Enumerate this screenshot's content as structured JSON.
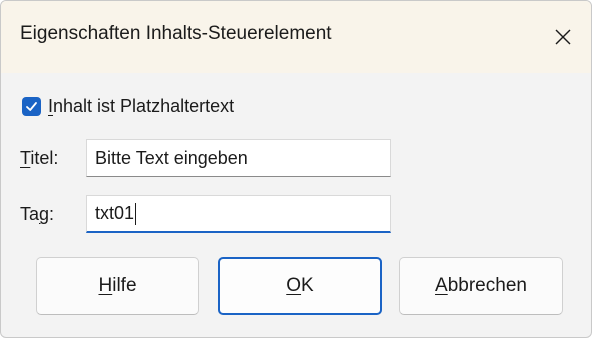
{
  "dialog": {
    "title": "Eigenschaften Inhalts-Steuerelement",
    "close_icon": "close-x"
  },
  "placeholder_checkbox": {
    "checked": true,
    "label_mnemonic": "I",
    "label_rest": "nhalt ist Platzhaltertext",
    "accent_color": "#1a63c5"
  },
  "title_field": {
    "label_mnemonic": "T",
    "label_rest": "itel:",
    "value": "Bitte Text eingeben"
  },
  "tag_field": {
    "label_pre": "Ta",
    "label_mnemonic": "g",
    "label_post": ":",
    "value": "txt01"
  },
  "buttons": {
    "help": {
      "mnemonic": "H",
      "rest": "ilfe"
    },
    "ok": {
      "mnemonic": "O",
      "rest": "K"
    },
    "cancel": {
      "mnemonic": "A",
      "rest": "bbrechen"
    }
  }
}
